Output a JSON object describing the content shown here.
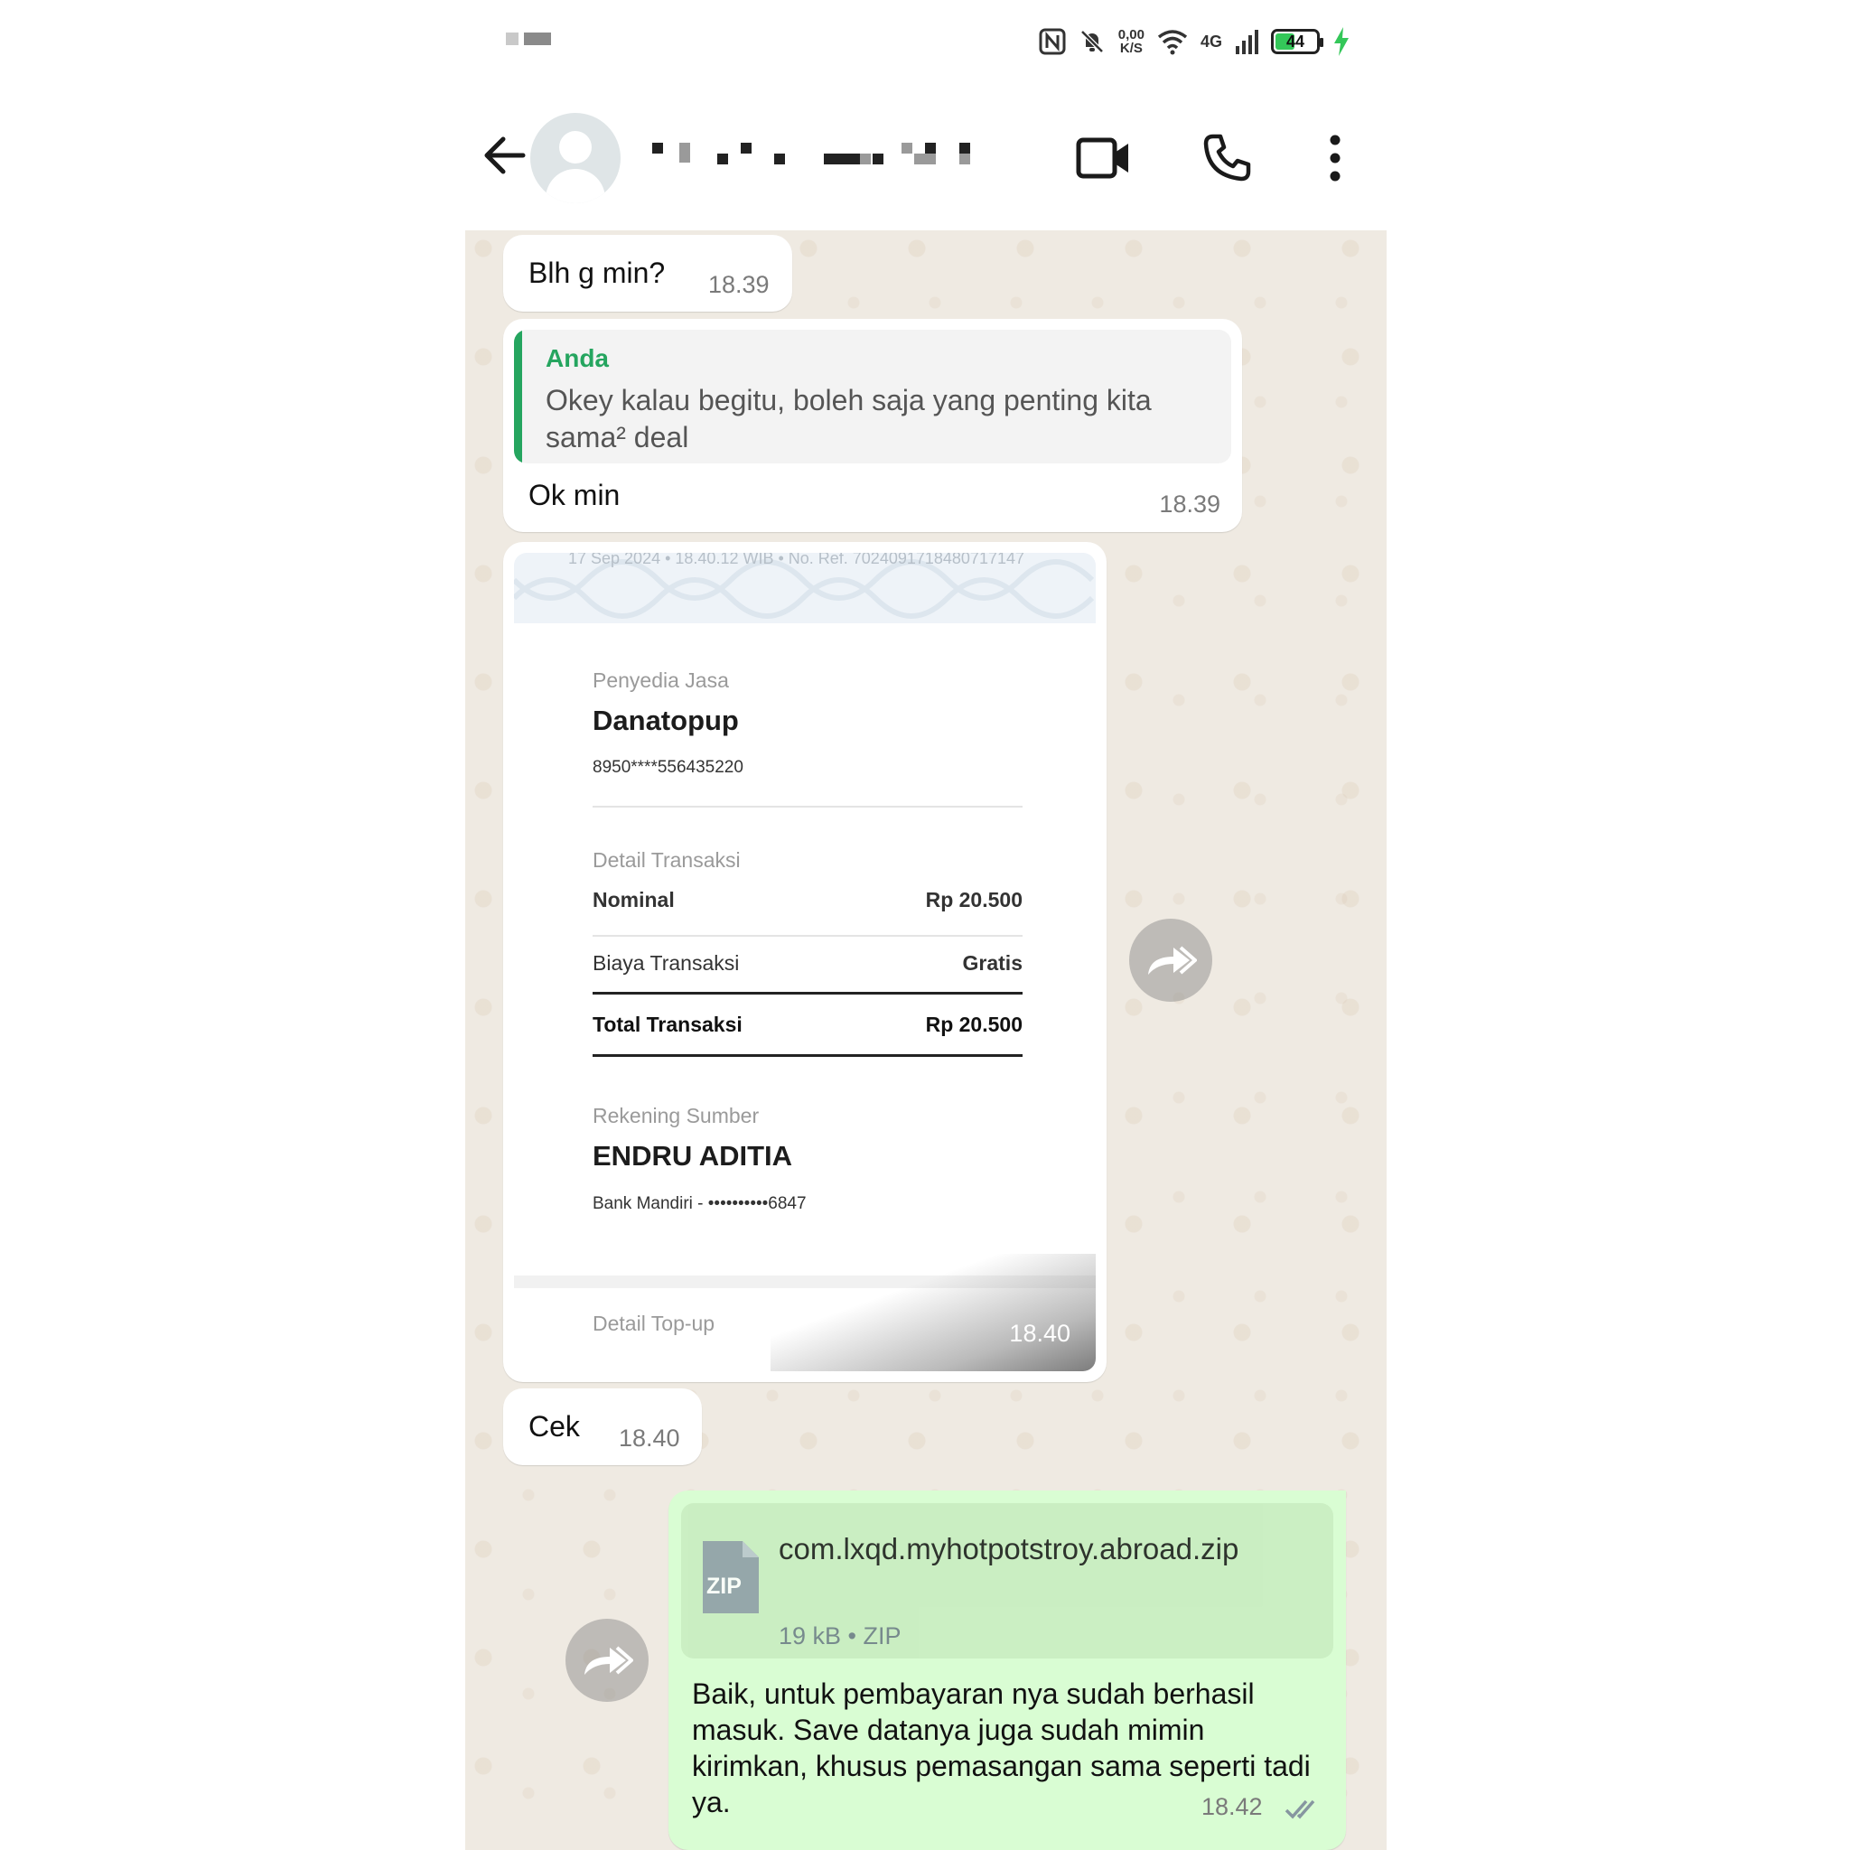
{
  "status_bar": {
    "net_speed": "0,00",
    "net_speed_unit": "K/S",
    "network": "4G",
    "battery_level": "44"
  },
  "messages": [
    {
      "type": "text",
      "direction": "in",
      "text": "Blh g min?",
      "time": "18.39"
    },
    {
      "type": "reply",
      "direction": "in",
      "quote_author": "Anda",
      "quote_text": "Okey kalau begitu, boleh saja yang penting kita sama² deal",
      "text": "Ok min",
      "time": "18.39"
    },
    {
      "type": "image",
      "direction": "in",
      "time": "18.40"
    },
    {
      "type": "text",
      "direction": "in",
      "text": "Cek",
      "time": "18.40"
    },
    {
      "type": "file",
      "direction": "out",
      "file_name": "com.lxqd.myhotpotstroy.abroad.zip",
      "file_meta": "19 kB • ZIP",
      "file_icon_label": "ZIP",
      "text": "Baik, untuk pembayaran nya sudah berhasil masuk. Save datanya juga sudah mimin kirimkan, khusus pemasangan sama seperti tadi ya.",
      "time": "18.42"
    }
  ],
  "receipt": {
    "header_line": "17 Sep 2024 • 18.40.12 WIB • No. Ref. 7024091718480717147",
    "provider_label": "Penyedia Jasa",
    "provider_name": "Danatopup",
    "provider_number": "8950****556435220",
    "detail_label": "Detail Transaksi",
    "rows": [
      {
        "label": "Nominal",
        "value": "Rp 20.500"
      },
      {
        "label": "Biaya Transaksi",
        "value": "Gratis"
      },
      {
        "label": "Total Transaksi",
        "value": "Rp 20.500"
      }
    ],
    "source_label": "Rekening Sumber",
    "source_name": "ENDRU ADITIA",
    "source_account": "Bank Mandiri - ••••••••••6847",
    "topup_label": "Detail Top-up"
  },
  "icons": {
    "back": "arrow-left-icon",
    "video": "video-camera-icon",
    "call": "phone-icon",
    "menu": "more-vertical-icon",
    "forward": "forward-icon",
    "read": "double-check-icon"
  },
  "colors": {
    "chat_bg": "#efeae2",
    "outgoing_bubble": "#d9fdd3",
    "accent_green": "#25a55f"
  }
}
